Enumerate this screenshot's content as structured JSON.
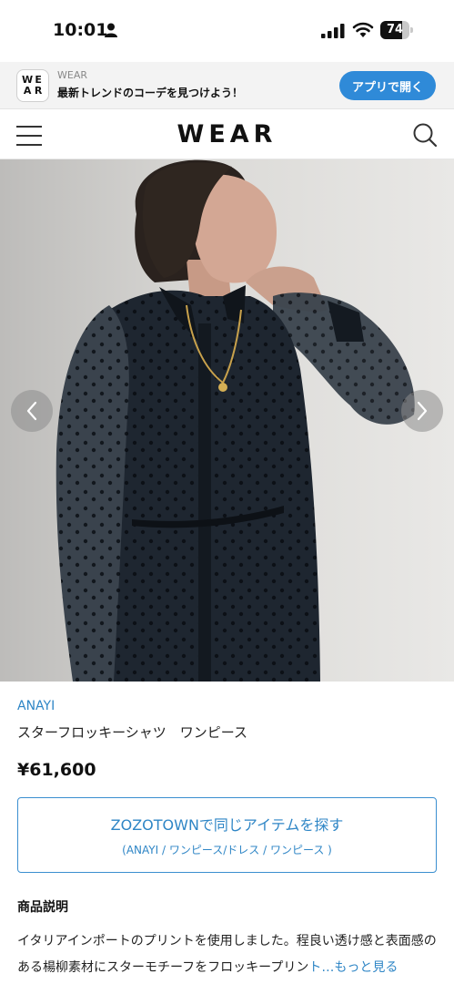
{
  "status_bar": {
    "time": "10:01",
    "battery_level": "74",
    "battery_fraction": 0.74
  },
  "app_banner": {
    "logo_letters": [
      "W",
      "E",
      "A",
      "R"
    ],
    "app_name": "WEAR",
    "tagline": "最新トレンドのコーデを見つけよう！",
    "open_button": "アプリで開く",
    "button_color": "#2f8ad8"
  },
  "header": {
    "logo": "WEAR",
    "menu_icon": "hamburger-icon",
    "search_icon": "search-icon"
  },
  "carousel": {
    "prev_icon": "chevron-left-icon",
    "next_icon": "chevron-right-icon"
  },
  "product": {
    "brand": "ANAYI",
    "name": "スターフロッキーシャツ　ワンピース",
    "price": "¥61,600",
    "zozo_button_title": "ZOZOTOWNで同じアイテムを探す",
    "zozo_button_sub": "(ANAYI / ワンピース/ドレス / ワンピース )",
    "accent_color": "#2f86c6"
  },
  "description": {
    "heading": "商品説明",
    "text": "イタリアインポートのプリントを使用しました。程良い透け感と表面感のある楊柳素材にスターモチーフをフロッキープリン",
    "read_more": "ト…もっと見る"
  }
}
